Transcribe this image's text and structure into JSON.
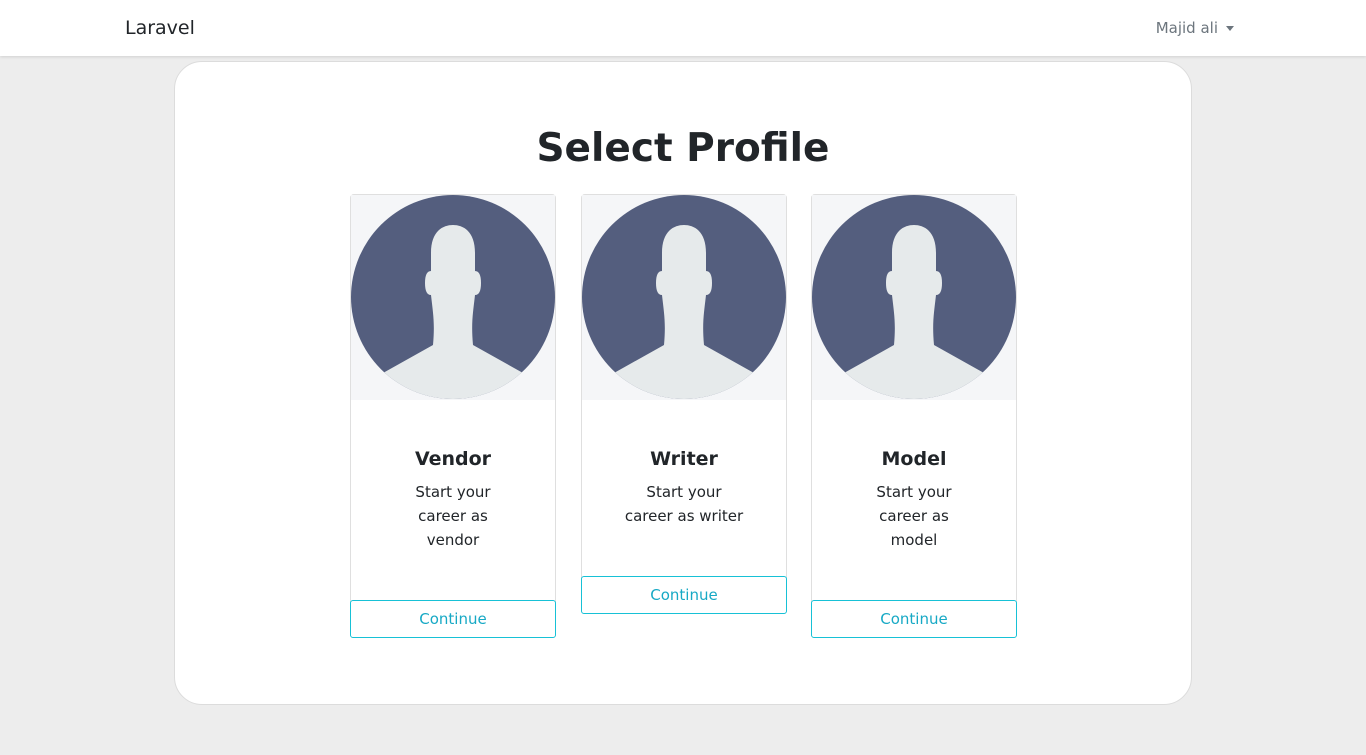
{
  "navbar": {
    "brand": "Laravel",
    "user_name": "Majid ali"
  },
  "main": {
    "title": "Select Profile",
    "cards": [
      {
        "title": "Vendor",
        "description": "Start your career as vendor",
        "button": "Continue",
        "icon": "user-avatar-icon"
      },
      {
        "title": "Writer",
        "description": "Start your career as writer",
        "button": "Continue",
        "icon": "user-avatar-icon"
      },
      {
        "title": "Model",
        "description": "Start your career as model",
        "button": "Continue",
        "icon": "user-avatar-icon"
      }
    ]
  },
  "colors": {
    "background": "#ededed",
    "panel": "#ffffff",
    "avatar_circle": "#545e7e",
    "avatar_figure": "#e6eaeb",
    "button_border": "#17c1d6",
    "button_text": "#17a9c5"
  }
}
